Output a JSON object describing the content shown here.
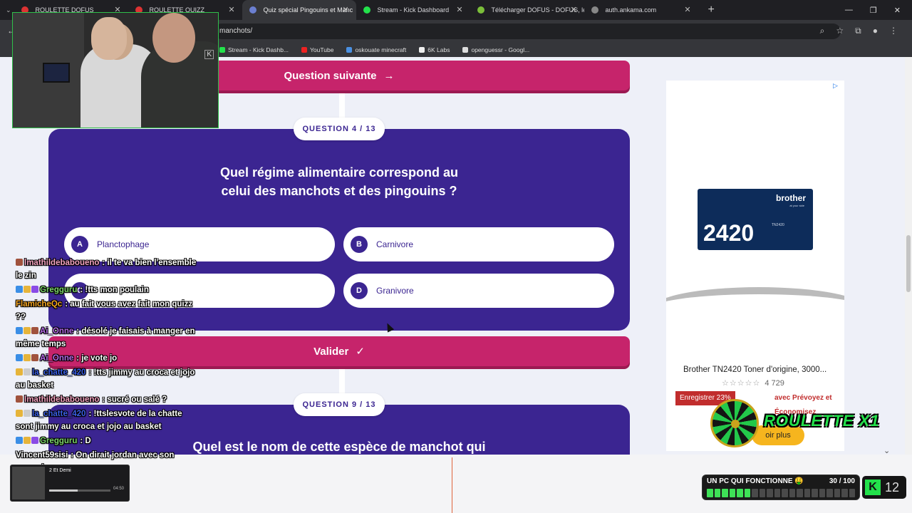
{
  "browser": {
    "tabs": [
      {
        "title": "ROULETTE DOFUS",
        "favicon_color": "#d33",
        "active": false
      },
      {
        "title": "ROULETTE QUIZZ",
        "favicon_color": "#d33",
        "active": false
      },
      {
        "title": "Quiz spécial Pingouins et Manc",
        "favicon_color": "#6b7fd1",
        "active": true
      },
      {
        "title": "Stream - Kick Dashboard",
        "favicon_color": "#23e14b",
        "active": false
      },
      {
        "title": "Télécharger DOFUS - DOFUS, le",
        "favicon_color": "#7bbf3a",
        "active": false
      },
      {
        "title": "auth.ankama.com",
        "favicon_color": "#888",
        "active": false
      }
    ],
    "url": "manchots/",
    "bookmarks": [
      {
        "label": "Stream - Kick Dashb...",
        "color": "#23e14b"
      },
      {
        "label": "YouTube",
        "color": "#e22"
      },
      {
        "label": "oskouate minecraft",
        "color": "#4a90e2"
      },
      {
        "label": "6K Labs",
        "color": "#eee"
      },
      {
        "label": "openguessr - Googl...",
        "color": "#ddd"
      }
    ]
  },
  "quiz": {
    "next_button": "Question suivante",
    "question_a": {
      "number": "QUESTION 4 / 13",
      "text_line1": "Quel régime alimentaire correspond au",
      "text_line2": "celui des manchots et des pingouins ?",
      "answers": [
        {
          "letter": "A",
          "text": "Planctophage"
        },
        {
          "letter": "B",
          "text": "Carnivore"
        },
        {
          "letter": "C",
          "text": ""
        },
        {
          "letter": "D",
          "text": "Granivore"
        }
      ]
    },
    "validate_button": "Valider",
    "question_b": {
      "number": "QUESTION 9 / 13",
      "text_line1": "Quel est le nom de cette espèce de manchot qui"
    }
  },
  "ad": {
    "brand": "brother",
    "brand_sub": "at your side",
    "model": "2420",
    "model_small": "TN2420",
    "title": "Brother TN2420 Toner d'origine, 3000...",
    "stars": "☆☆☆☆☆",
    "rating_count": "4 729",
    "promo": "Enregistrer 23%",
    "promo_tail": "avec Prévoyez et Économisez",
    "more": "oir plus"
  },
  "chat": [
    {
      "user": "lmathildebaboueno",
      "color": "#f4a3c0",
      "text": "il te va bien l'ensemble le zin",
      "badges": [
        "#a0523d"
      ]
    },
    {
      "user": "Gregguru",
      "color": "#7bd46a",
      "text": "!tts mon poulain",
      "badges": [
        "#3a8ee6",
        "#e6b43a",
        "#8a4be6"
      ]
    },
    {
      "user": "FlamicheQc",
      "color": "#f5a623",
      "text": "au fait vous avez fait mon quizz ??",
      "badges": []
    },
    {
      "user": "Ai_Onne",
      "color": "#b46be6",
      "text": "désolé je faisais à manger en même temps",
      "badges": [
        "#3a8ee6",
        "#e6b43a",
        "#a0523d"
      ]
    },
    {
      "user": "Ai_Onne",
      "color": "#b46be6",
      "text": "je vote jo",
      "badges": [
        "#3a8ee6",
        "#e6b43a",
        "#a0523d"
      ]
    },
    {
      "user": "la_chatte_420",
      "color": "#3a5fe6",
      "text": "!tts jimmy au croca et jojo au basket",
      "badges": [
        "#e6b43a",
        "#ccc"
      ]
    },
    {
      "user": "lmathildebaboueno",
      "color": "#f4a3c0",
      "text": "sucré ou salé ?",
      "badges": [
        "#a0523d"
      ]
    },
    {
      "user": "la_chatte_420",
      "color": "#3a5fe6",
      "text": "!ttslesvote de la chatte sont jimmy au croca et jojo au basket",
      "badges": [
        "#e6b43a",
        "#ccc"
      ]
    },
    {
      "user": "Gregguru",
      "color": "#7bd46a",
      "text": "D",
      "badges": [
        "#3a8ee6",
        "#e6b43a",
        "#8a4be6"
      ]
    },
    {
      "user": "Vincent59sisi",
      "color": "#fff",
      "text": "On dirait jordan avec son ensembe",
      "badges": []
    }
  ],
  "now_playing": {
    "title": "2 Et Demi",
    "time": "04:50",
    "progress": 0.46
  },
  "roulette": {
    "label": "ROULETTE X1"
  },
  "goal": {
    "label": "UN PC QUI FONCTIONNE 🤑",
    "count": "30 / 100",
    "progress": 0.3
  },
  "kick": {
    "viewers": "12"
  }
}
